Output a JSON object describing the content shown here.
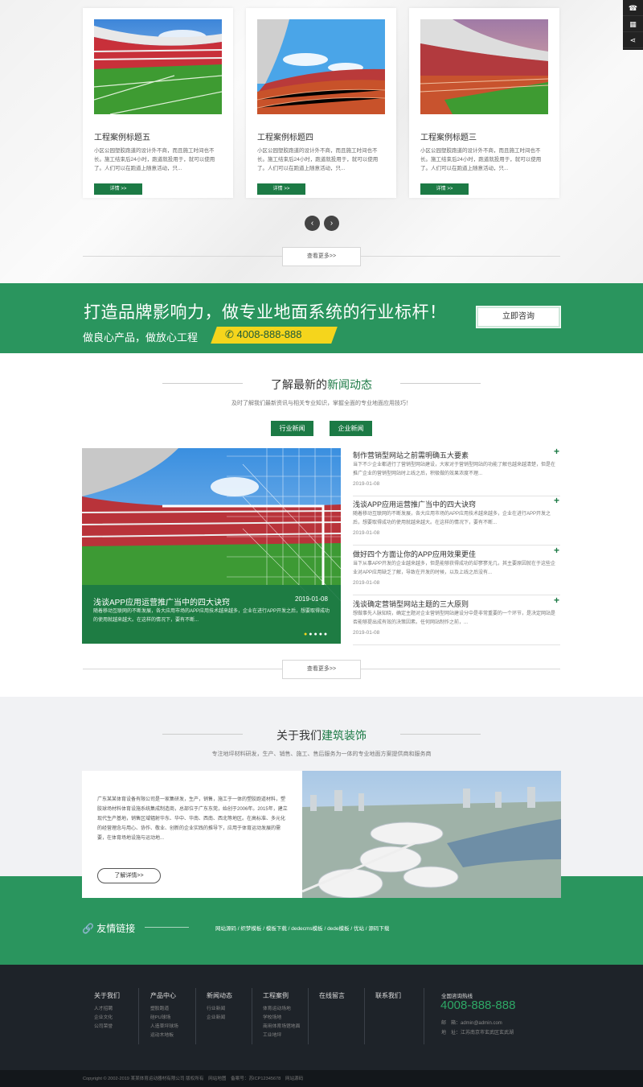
{
  "cases": [
    {
      "title": "工程案例标题五",
      "desc": "小区公园塑胶跑道的设计外不商，而且施工时间也不长。施工结束后24小时，跑道就投用于，就可以使用了。人们可以在跑道上随意活动，只...",
      "btn": "详情 >>"
    },
    {
      "title": "工程案例标题四",
      "desc": "小区公园塑胶跑道的设计外不商，而且施工时间也不长。施工结束后24小时，跑道就投用于，就可以使用了。人们可以在跑道上随意活动，只...",
      "btn": "详情 >>"
    },
    {
      "title": "工程案例标题三",
      "desc": "小区公园塑胶跑道的设计外不商，而且施工时间也不长。施工结束后24小时，跑道就投用于，就可以使用了。人们可以在跑道上随意活动，只...",
      "btn": "详情 >>"
    }
  ],
  "prev_arrow": "‹",
  "next_arrow": "›",
  "more_label": "查看更多>>",
  "banner": {
    "headline": "打造品牌影响力，做专业地面系统的行业标杆！",
    "slogan": "做良心产品，做放心工程",
    "phone": "4008-888-888",
    "consult": "立即咨询"
  },
  "news": {
    "title_plain": "了解最新的",
    "title_green": "新闻动态",
    "subtitle": "及时了解我们最新资讯与相关专业知识，掌握全面的专业地面应用技巧！",
    "tabs": [
      "行业新闻",
      "企业新闻"
    ],
    "featured": {
      "title": "浅谈APP应用运营推广当中的四大诀窍",
      "date": "2019-01-08",
      "desc": "随着移动互联网的不断发展，各大应用市场的APP应用技术越来越多，企业在进行APP开发之后，想要取得成功的使用就越来越大。在这样的情况下，要有不断..."
    },
    "items": [
      {
        "title": "制作营销型网站之前需明确五大要素",
        "desc": "当下不少企业都进行了营销型网站建设，大家对于营销型网站的功能了解也越来越清楚，但是在推广企业的营销型网站时上线之后，积极做的效果浓度不理...",
        "date": "2019-01-08"
      },
      {
        "title": "浅谈APP应用运营推广当中的四大诀窍",
        "desc": "随着移动互联网的不断发展，各大应用市场的APP应用技术越来越多，企业在进行APP开发之后，想要取得成功的使用就越来越大。在这样的情况下，要有不断...",
        "date": "2019-01-08"
      },
      {
        "title": "做好四个方面让你的APP应用效果更佳",
        "desc": "当下从事APP开发的企业越来越多，但是能够获得成功的却寥寥无几，其主要原因就在于这些企业对APP应用缺乏了解，导致在开发的时候，以及上线之后没有...",
        "date": "2019-01-08"
      },
      {
        "title": "浅谈确定营销型网站主题的三大原则",
        "desc": "想做事先人脉知晓，确定主题对企业营销型网站建设分中是非常重要的一个环节，是决定网站是否能够提出成有效的决策因素。任何网站制作之前，...",
        "date": "2019-01-08"
      }
    ],
    "plus": "+"
  },
  "about": {
    "title_plain": "关于我们",
    "title_green": "建筑装饰",
    "subtitle": "专注地坪材料研发，生产、销售、施工、售后服务为一体的专业地面方案提供商和服务商",
    "text": "广东某某体育设备有限公司是一家集研发，生产，销售，施工于一体的塑胶跑道材料，塑胶球场材料体育设施系统集成制造商，总部位于广东东莞，始创于2006年。2015年，建立现代生产基地，销售区域辐射华东、华中、华南、西南、西北等地区。在高标准、多元化的经营理念与用心、协作、敬业、创新的企业实践的推导下，应用于体育运动发展的需要，在体育场地设施与运动地...",
    "btn": "了解详情>>"
  },
  "links": {
    "title": "友情链接",
    "items": [
      "网站源码",
      "织梦模板",
      "模板下载",
      "dedecms模板",
      "dede模板",
      "优站",
      "源码下载"
    ]
  },
  "footer": {
    "cols": [
      {
        "h": "关于我们",
        "items": [
          "人才招聘",
          "企业文化",
          "公司荣誉"
        ]
      },
      {
        "h": "产品中心",
        "items": [
          "塑胶跑道",
          "硅PU球场",
          "人造草坪球场",
          "运动木地板"
        ]
      },
      {
        "h": "新闻动态",
        "items": [
          "行业新闻",
          "企业新闻"
        ]
      },
      {
        "h": "工程案例",
        "items": [
          "体育运动场地",
          "学校场地",
          "商用体育场馆地面",
          "工业地坪"
        ]
      },
      {
        "h": "在线留言",
        "items": []
      },
      {
        "h": "联系我们",
        "items": []
      }
    ],
    "hotline_label": "全国咨询热线",
    "hotline": "4008-888-888",
    "email": "邮　箱：admin@admin.com",
    "address": "地　址：江苏南京市玄武区玄武湖",
    "copyright": "Copyright © 2002-2019 某某体育运动器材有限公司 版权所有　网站地图　备案号：苏ICP12345678　网站源码"
  },
  "side_icons": [
    "phone-icon",
    "qr-icon",
    "share-icon"
  ],
  "colors": {
    "green": "#1c7a45",
    "banner_green": "#2a955e",
    "yellow": "#f5d51c",
    "footer": "#1e2329"
  }
}
